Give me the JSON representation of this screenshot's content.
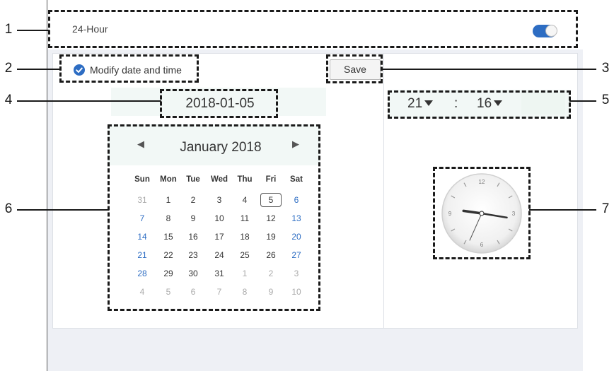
{
  "settings": {
    "hour_mode_label": "24-Hour",
    "hour_mode_enabled": true,
    "modify_label": "Modify date and time",
    "modify_checked": true,
    "save_label": "Save"
  },
  "date": {
    "value": "2018-01-05"
  },
  "time": {
    "hour": "21",
    "separator": ":",
    "minute": "16"
  },
  "calendar": {
    "month_title": "January 2018",
    "prev_icon": "◀",
    "next_icon": "▶",
    "weekdays": [
      "Sun",
      "Mon",
      "Tue",
      "Wed",
      "Thu",
      "Fri",
      "Sat"
    ],
    "selected_day": "5",
    "weeks": [
      [
        "31",
        "1",
        "2",
        "3",
        "4",
        "5",
        "6"
      ],
      [
        "7",
        "8",
        "9",
        "10",
        "11",
        "12",
        "13"
      ],
      [
        "14",
        "15",
        "16",
        "17",
        "18",
        "19",
        "20"
      ],
      [
        "21",
        "22",
        "23",
        "24",
        "25",
        "26",
        "27"
      ],
      [
        "28",
        "29",
        "30",
        "31",
        "1",
        "2",
        "3"
      ],
      [
        "4",
        "5",
        "6",
        "7",
        "8",
        "9",
        "10"
      ]
    ]
  },
  "clock": {
    "numerals": [
      "12",
      "3",
      "6",
      "9"
    ],
    "hour": 21,
    "minute": 16,
    "second": 34
  },
  "callouts": [
    "1",
    "2",
    "3",
    "4",
    "5",
    "6",
    "7"
  ],
  "colors": {
    "accent": "#2d6dc3",
    "weekend": "#2d6dc3",
    "strip": "#f2f8f6",
    "background": "#eef0f5"
  },
  "icons": {
    "toggle": "toggle-on-icon",
    "check": "checkmark-circle-icon",
    "prev": "chevron-left-icon",
    "next": "chevron-right-icon",
    "caret": "caret-down-icon",
    "clock": "analog-clock-icon"
  }
}
